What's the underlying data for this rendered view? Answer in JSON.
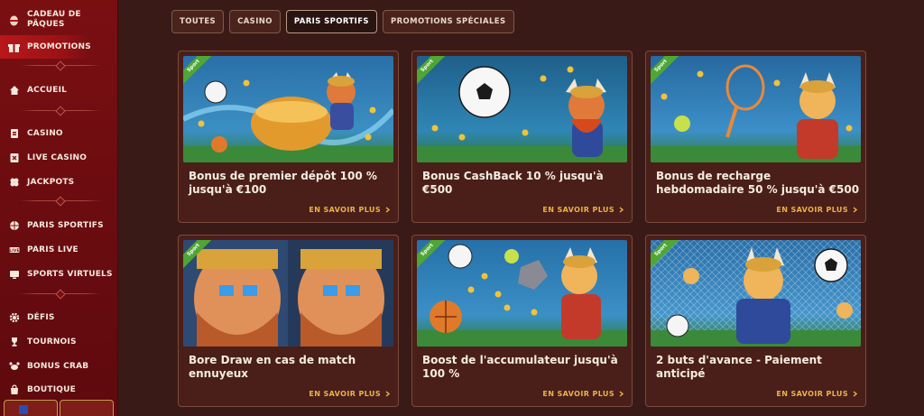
{
  "sidebar": {
    "items": [
      {
        "label": "CADEAU DE PÂQUES",
        "icon": "easter-egg-icon"
      },
      {
        "label": "PROMOTIONS",
        "icon": "gift-icon",
        "active": true
      },
      {
        "label": "ACCUEIL",
        "icon": "home-icon"
      },
      {
        "label": "CASINO",
        "icon": "cards-icon"
      },
      {
        "label": "LIVE CASINO",
        "icon": "live-casino-icon"
      },
      {
        "label": "JACKPOTS",
        "icon": "clover-icon"
      },
      {
        "label": "PARIS SPORTIFS",
        "icon": "ball-icon"
      },
      {
        "label": "PARIS LIVE",
        "icon": "live-icon"
      },
      {
        "label": "SPORTS VIRTUELS",
        "icon": "monitor-icon"
      },
      {
        "label": "DÉFIS",
        "icon": "gear-icon"
      },
      {
        "label": "TOURNOIS",
        "icon": "trophy-icon"
      },
      {
        "label": "BONUS CRAB",
        "icon": "crab-icon"
      },
      {
        "label": "BOUTIQUE",
        "icon": "shop-icon"
      }
    ]
  },
  "tabs": [
    {
      "label": "TOUTES"
    },
    {
      "label": "CASINO"
    },
    {
      "label": "PARIS SPORTIFS",
      "active": true
    },
    {
      "label": "PROMOTIONS SPÉCIALES"
    }
  ],
  "cards": [
    {
      "badge": "Sport",
      "title": "Bonus de premier dépôt 100 % jusqu'à €100",
      "link": "EN SAVOIR PLUS"
    },
    {
      "badge": "Sport",
      "title": "Bonus CashBack 10 % jusqu'à €500",
      "link": "EN SAVOIR PLUS"
    },
    {
      "badge": "Sport",
      "title": "Bonus de recharge hebdomadaire 50 % jusqu'à €500",
      "link": "EN SAVOIR PLUS"
    },
    {
      "badge": "Sport",
      "title": "Bore Draw en cas de match ennuyeux",
      "link": "EN SAVOIR PLUS"
    },
    {
      "badge": "Sport",
      "title": "Boost de l'accumulateur jusqu'à 100 %",
      "link": "EN SAVOIR PLUS"
    },
    {
      "badge": "Sport",
      "title": "2 buts d'avance - Paiement anticipé",
      "link": "EN SAVOIR PLUS"
    }
  ],
  "colors": {
    "sidebar": "#7a0f12",
    "background": "#3a1a16",
    "card": "#4a1f19",
    "accent": "#ebb24a",
    "badge": "#4fa634"
  }
}
